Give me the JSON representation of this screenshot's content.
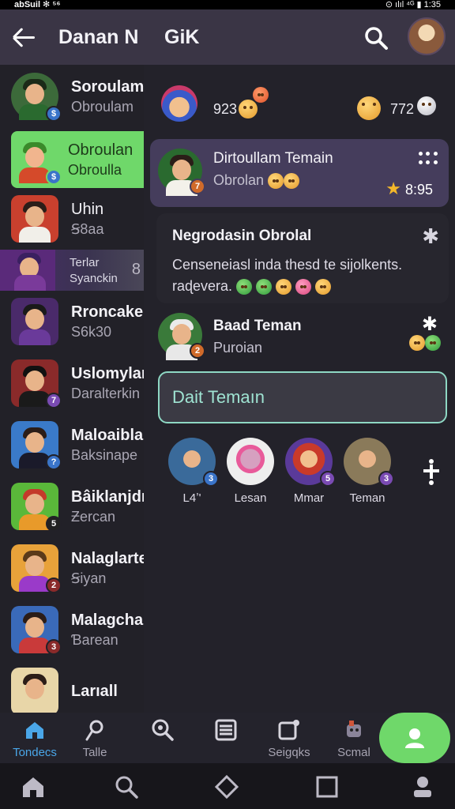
{
  "status_bar": {
    "left": "abSuil ✻ ⁵⁶",
    "right": "⊙ ılıl ⁴ᴳ ▮ 1:35"
  },
  "drawer": {
    "title": "Danan N",
    "contacts": [
      {
        "name": "Soroulam",
        "sub": "Obroulam",
        "badge": "",
        "badge_color": "#3a74c9"
      },
      {
        "name": "Obroulan",
        "sub": "Obroulla",
        "badge": "$",
        "badge_color": "#3a74c9"
      },
      {
        "name": "Uhin",
        "sub": "Ꞩ8aa",
        "badge": "",
        "badge_color": "#b1324a"
      },
      {
        "name": "Terlar",
        "sub": "Syanckin",
        "badge": "8",
        "badge_color": "#777"
      },
      {
        "name": "Rroncake",
        "sub": "S6k30",
        "badge": "",
        "badge_color": "#7a4bb3"
      },
      {
        "name": "Uslomylar",
        "sub": "Daralterkin",
        "badge": "7",
        "badge_color": "#7a4bb3"
      },
      {
        "name": "Maloaibla",
        "sub": "Baksinape",
        "badge": "?",
        "badge_color": "#3a74c9"
      },
      {
        "name": "Bâiklanjdı",
        "sub": "Ƶercan",
        "badge": "5",
        "badge_color": "#222"
      },
      {
        "name": "Nalaglarte",
        "sub": "Ꞩiyan",
        "badge": "2",
        "badge_color": "#8a2a2a"
      },
      {
        "name": "Malagcha",
        "sub": "Ɓarean",
        "badge": "3",
        "badge_color": "#8a2a2a"
      },
      {
        "name": "Larıall",
        "sub": "",
        "badge": "",
        "badge_color": "#222"
      }
    ]
  },
  "main": {
    "title": "GiK",
    "stats": {
      "left": "923",
      "right": "772"
    },
    "chat_card": {
      "title": "Dirtoullam Temain",
      "sub": "Obrolan",
      "time": "8:95",
      "badge": "7"
    },
    "notice": {
      "title": "Negrodasin Obrolal",
      "body": "Censeneiasl inda thesd te sijolkents. raɖevera."
    },
    "friend": {
      "title": "Baad Teman",
      "sub": "Puroian",
      "badge": "2"
    },
    "input": {
      "value": "Dait Temaın"
    },
    "stories": [
      {
        "label": "L4ʼ'",
        "badge": "3"
      },
      {
        "label": "Lesan",
        "badge": ""
      },
      {
        "label": "Mmar",
        "badge": "5"
      },
      {
        "label": "Teman",
        "badge": "3"
      }
    ]
  },
  "tabs": [
    {
      "label": "Tondecs",
      "icon": "home-icon"
    },
    {
      "label": "Talle",
      "icon": "pin-icon"
    },
    {
      "label": "",
      "icon": "search-icon"
    },
    {
      "label": "",
      "icon": "list-icon"
    },
    {
      "label": "Seigqks",
      "icon": "compose-icon"
    },
    {
      "label": "Scmal",
      "icon": "mascot-icon"
    }
  ],
  "colors": {
    "accent_green": "#6fd86a",
    "accent_blue": "#4aa6e8",
    "header": "#3a3545",
    "input_border": "#8ed8c4"
  }
}
